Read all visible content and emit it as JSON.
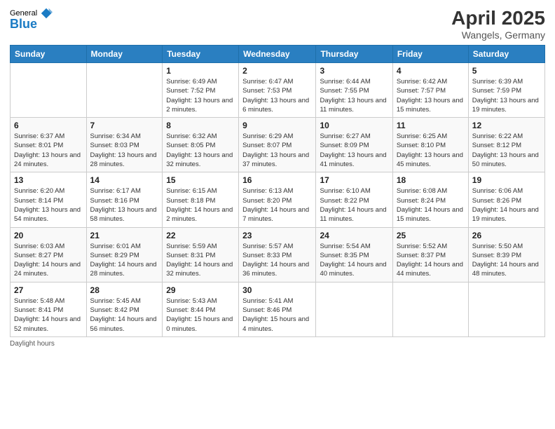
{
  "logo": {
    "general": "General",
    "blue": "Blue"
  },
  "title": "April 2025",
  "location": "Wangels, Germany",
  "days_of_week": [
    "Sunday",
    "Monday",
    "Tuesday",
    "Wednesday",
    "Thursday",
    "Friday",
    "Saturday"
  ],
  "footer": "Daylight hours",
  "weeks": [
    [
      {
        "day": null,
        "info": null
      },
      {
        "day": null,
        "info": null
      },
      {
        "day": "1",
        "info": "Sunrise: 6:49 AM\nSunset: 7:52 PM\nDaylight: 13 hours and 2 minutes."
      },
      {
        "day": "2",
        "info": "Sunrise: 6:47 AM\nSunset: 7:53 PM\nDaylight: 13 hours and 6 minutes."
      },
      {
        "day": "3",
        "info": "Sunrise: 6:44 AM\nSunset: 7:55 PM\nDaylight: 13 hours and 11 minutes."
      },
      {
        "day": "4",
        "info": "Sunrise: 6:42 AM\nSunset: 7:57 PM\nDaylight: 13 hours and 15 minutes."
      },
      {
        "day": "5",
        "info": "Sunrise: 6:39 AM\nSunset: 7:59 PM\nDaylight: 13 hours and 19 minutes."
      }
    ],
    [
      {
        "day": "6",
        "info": "Sunrise: 6:37 AM\nSunset: 8:01 PM\nDaylight: 13 hours and 24 minutes."
      },
      {
        "day": "7",
        "info": "Sunrise: 6:34 AM\nSunset: 8:03 PM\nDaylight: 13 hours and 28 minutes."
      },
      {
        "day": "8",
        "info": "Sunrise: 6:32 AM\nSunset: 8:05 PM\nDaylight: 13 hours and 32 minutes."
      },
      {
        "day": "9",
        "info": "Sunrise: 6:29 AM\nSunset: 8:07 PM\nDaylight: 13 hours and 37 minutes."
      },
      {
        "day": "10",
        "info": "Sunrise: 6:27 AM\nSunset: 8:09 PM\nDaylight: 13 hours and 41 minutes."
      },
      {
        "day": "11",
        "info": "Sunrise: 6:25 AM\nSunset: 8:10 PM\nDaylight: 13 hours and 45 minutes."
      },
      {
        "day": "12",
        "info": "Sunrise: 6:22 AM\nSunset: 8:12 PM\nDaylight: 13 hours and 50 minutes."
      }
    ],
    [
      {
        "day": "13",
        "info": "Sunrise: 6:20 AM\nSunset: 8:14 PM\nDaylight: 13 hours and 54 minutes."
      },
      {
        "day": "14",
        "info": "Sunrise: 6:17 AM\nSunset: 8:16 PM\nDaylight: 13 hours and 58 minutes."
      },
      {
        "day": "15",
        "info": "Sunrise: 6:15 AM\nSunset: 8:18 PM\nDaylight: 14 hours and 2 minutes."
      },
      {
        "day": "16",
        "info": "Sunrise: 6:13 AM\nSunset: 8:20 PM\nDaylight: 14 hours and 7 minutes."
      },
      {
        "day": "17",
        "info": "Sunrise: 6:10 AM\nSunset: 8:22 PM\nDaylight: 14 hours and 11 minutes."
      },
      {
        "day": "18",
        "info": "Sunrise: 6:08 AM\nSunset: 8:24 PM\nDaylight: 14 hours and 15 minutes."
      },
      {
        "day": "19",
        "info": "Sunrise: 6:06 AM\nSunset: 8:26 PM\nDaylight: 14 hours and 19 minutes."
      }
    ],
    [
      {
        "day": "20",
        "info": "Sunrise: 6:03 AM\nSunset: 8:27 PM\nDaylight: 14 hours and 24 minutes."
      },
      {
        "day": "21",
        "info": "Sunrise: 6:01 AM\nSunset: 8:29 PM\nDaylight: 14 hours and 28 minutes."
      },
      {
        "day": "22",
        "info": "Sunrise: 5:59 AM\nSunset: 8:31 PM\nDaylight: 14 hours and 32 minutes."
      },
      {
        "day": "23",
        "info": "Sunrise: 5:57 AM\nSunset: 8:33 PM\nDaylight: 14 hours and 36 minutes."
      },
      {
        "day": "24",
        "info": "Sunrise: 5:54 AM\nSunset: 8:35 PM\nDaylight: 14 hours and 40 minutes."
      },
      {
        "day": "25",
        "info": "Sunrise: 5:52 AM\nSunset: 8:37 PM\nDaylight: 14 hours and 44 minutes."
      },
      {
        "day": "26",
        "info": "Sunrise: 5:50 AM\nSunset: 8:39 PM\nDaylight: 14 hours and 48 minutes."
      }
    ],
    [
      {
        "day": "27",
        "info": "Sunrise: 5:48 AM\nSunset: 8:41 PM\nDaylight: 14 hours and 52 minutes."
      },
      {
        "day": "28",
        "info": "Sunrise: 5:45 AM\nSunset: 8:42 PM\nDaylight: 14 hours and 56 minutes."
      },
      {
        "day": "29",
        "info": "Sunrise: 5:43 AM\nSunset: 8:44 PM\nDaylight: 15 hours and 0 minutes."
      },
      {
        "day": "30",
        "info": "Sunrise: 5:41 AM\nSunset: 8:46 PM\nDaylight: 15 hours and 4 minutes."
      },
      {
        "day": null,
        "info": null
      },
      {
        "day": null,
        "info": null
      },
      {
        "day": null,
        "info": null
      }
    ]
  ]
}
